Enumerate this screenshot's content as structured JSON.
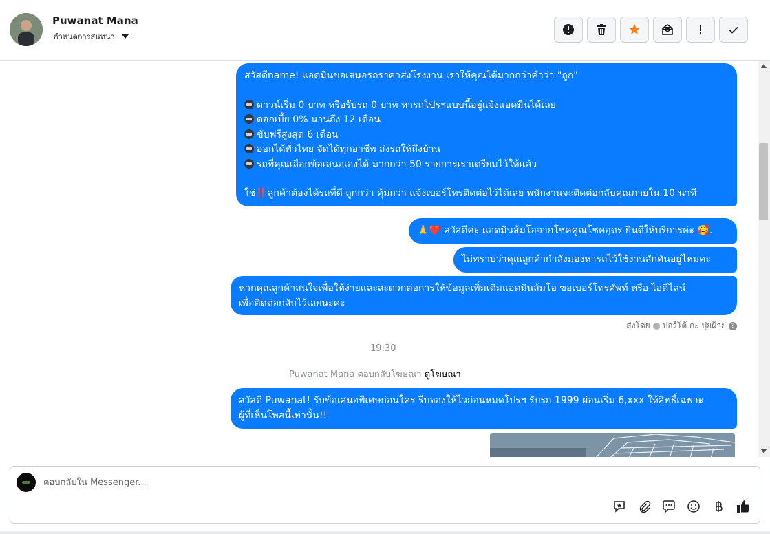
{
  "header": {
    "user_name": "Puwanat Mana",
    "subtitle": "กำหนดการสนทนา",
    "actions": [
      {
        "icon": "alert-circle-icon"
      },
      {
        "icon": "trash-icon"
      },
      {
        "icon": "star-icon",
        "color": "#f5821f"
      },
      {
        "icon": "mark-unread-icon"
      },
      {
        "icon": "exclamation-icon"
      },
      {
        "icon": "checkmark-icon"
      }
    ]
  },
  "messages": {
    "m1": {
      "greeting": "สวัสดีname! แอดมินขอเสนอรถราคาส่งโรงงาน เราให้คุณได้มากกว่าคำว่า \"ถูก\"",
      "items": [
        "ดาวน์เริ่ม 0 บาท หรือรับรถ 0 บาท หารถโปรฯแบบนี้อยู่แจ้งแอดมินได้เลย",
        "ดอกเบี้ย 0% นานถึง 12 เดือน",
        "ขับฟรีสูงสุด 6 เดือน",
        "ออกได้ทั่วไทย จัดได้ทุกอาชีพ ส่งรถให้ถึงบ้าน",
        "รถที่คุณเลือกข้อเสนอเองได้ มากกว่า 50 รายการเราเตรียมไว้ให้แล้ว"
      ],
      "closing_prefix": "ใช่",
      "closing_emoji": "‼️",
      "closing": "ลูกค้าต้องได้รถที่ดี ถูกกว่า คุ้มกว่า แจ้งเบอร์โทรติดต่อไว้ได้เลย พนักงานจะติดต่อกลับคุณภายใน 10 นาที"
    },
    "m2": {
      "emoji_prefix": "🙏❤️",
      "text": "สวัสดีค่ะ แอดมินส้มโอจากโชคคูณโชคอุดร ยินดีให้บริการค่ะ",
      "emoji_suffix": "🥰."
    },
    "m3": "ไม่ทราบว่าคุณลูกค้ากำลังมองหารถไว้ใช้งานสักคันอยู่ไหมคะ",
    "m4": {
      "line1": "หากคุณลูกค้าสนใจเพื่อให้ง่ายและสะดวกต่อการให้ข้อมูลเพิ่มเติมแอดมินส้มโอ ขอเบอร์โทรศัพท์ หรือ ไอดีไลน์",
      "line2": "เพื่อติดต่อกลับไว้เลยนะคะ"
    },
    "sent_by_label": "ส่งโดย",
    "sent_by_name": "ปอร์โต้ กะ ปุยฝ้าย",
    "time": "19:30",
    "reply_note": "Puwanat Mana ตอบกลับโฆษณา",
    "reply_link": "ดูโฆษณา",
    "m5": {
      "line1": "สวัสดี Puwanat! รับข้อเสนอพิเศษก่อนใคร รีบจองให้ไวก่อนหมดโปรฯ รับรถ 1999 ผ่อนเริ่ม 6,xxx ให้สิทธิ์เฉพาะ",
      "line2": "ผู้ที่เห็นโพสนี้เท่านั้น!!"
    },
    "bubble_color": "#0a7cff"
  },
  "composer": {
    "placeholder": "ตอบกลับใน Messenger...",
    "tools": [
      "saved-reply-icon",
      "attachment-icon",
      "chat-bubble-icon",
      "emoji-icon",
      "baht-payment-icon",
      "thumbs-up-icon"
    ]
  }
}
